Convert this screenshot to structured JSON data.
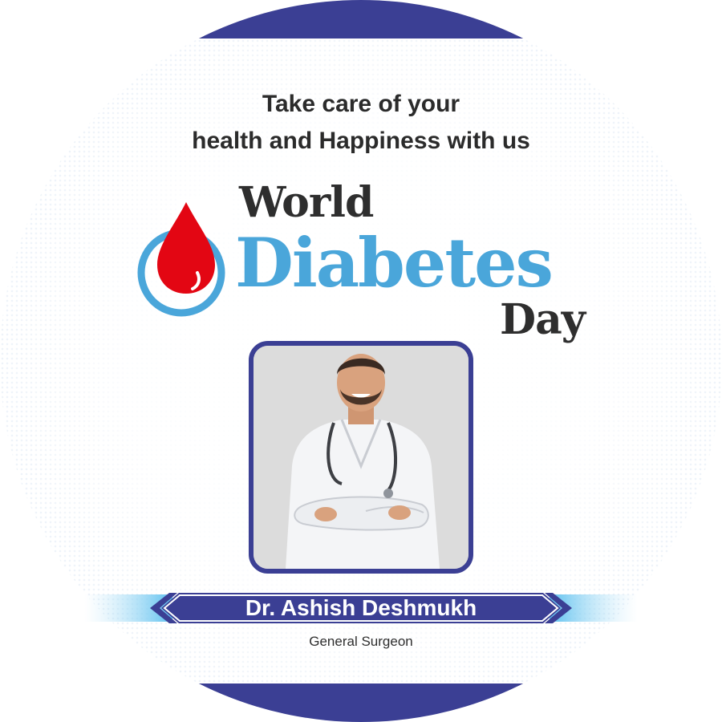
{
  "tagline": {
    "line1": "Take care of your",
    "line2": "health and Happiness with us"
  },
  "title": {
    "world": "World",
    "diabetes": "Diabetes",
    "day": "Day"
  },
  "doctor": {
    "name": "Dr. Ashish Deshmukh",
    "role": "General Surgeon"
  },
  "icons": {
    "blood_drop": "blood-drop-icon"
  },
  "colors": {
    "navy": "#3b3f94",
    "diabetes_blue": "#4aa6da",
    "drop_red": "#e30613",
    "text_dark": "#2e2e2e"
  }
}
